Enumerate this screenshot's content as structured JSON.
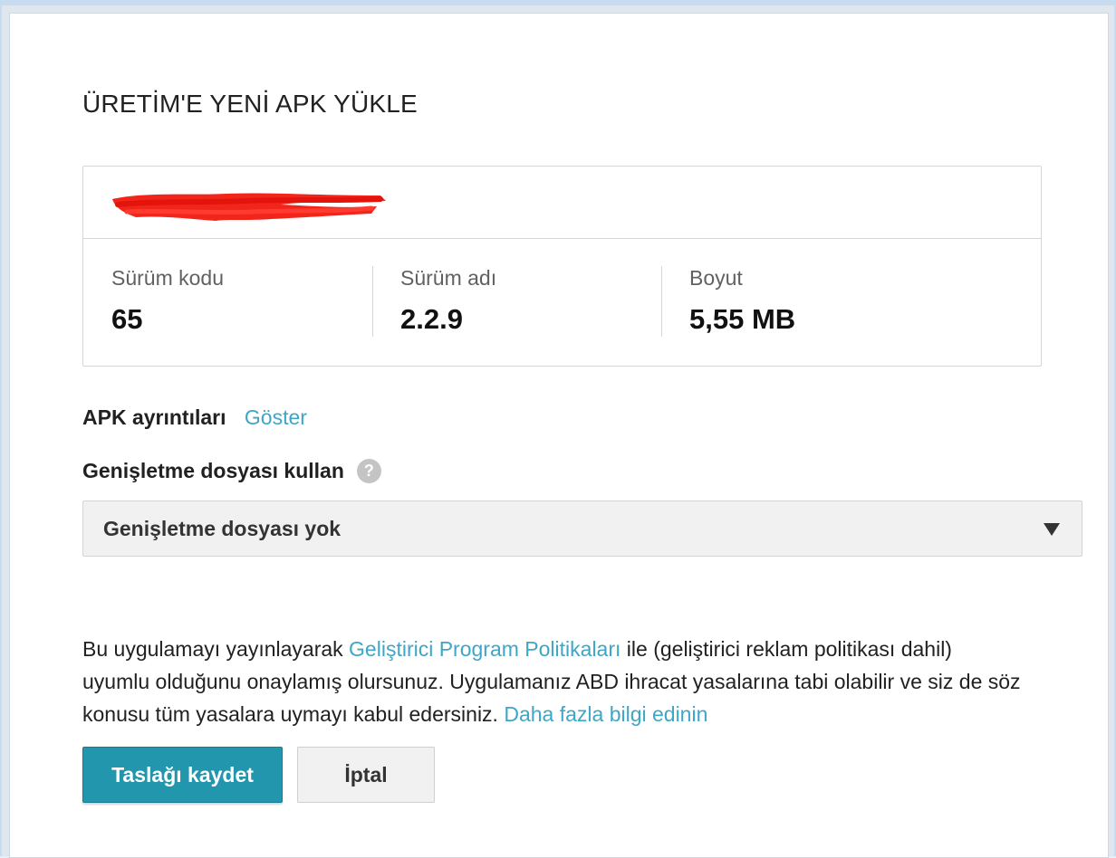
{
  "dialog": {
    "title": "ÜRETİM'E YENİ APK YÜKLE"
  },
  "apk": {
    "name_redacted": true,
    "stats": [
      {
        "label": "Sürüm kodu",
        "value": "65"
      },
      {
        "label": "Sürüm adı",
        "value": "2.2.9"
      },
      {
        "label": "Boyut",
        "value": "5,55 MB"
      }
    ]
  },
  "details": {
    "label": "APK ayrıntıları",
    "link": "Göster"
  },
  "expansion": {
    "label": "Genişletme dosyası kullan",
    "help_icon": "?",
    "selected": "Genişletme dosyası yok"
  },
  "policy": {
    "text_1": "Bu uygulamayı yayınlayarak ",
    "link_1": "Geliştirici Program Politikaları",
    "text_2": " ile (geliştirici reklam politikası dahil) uyumlu olduğunu onaylamış olursunuz. Uygulamanız ABD ihracat yasalarına tabi olabilir ve siz de söz konusu tüm yasalara uymayı kabul edersiniz. ",
    "link_2": "Daha fazla bilgi edinin"
  },
  "buttons": {
    "save_draft": "Taslağı kaydet",
    "cancel": "İptal"
  },
  "colors": {
    "accent": "#2196ad",
    "link": "#3ea6c6",
    "redaction": "#f2251b"
  }
}
